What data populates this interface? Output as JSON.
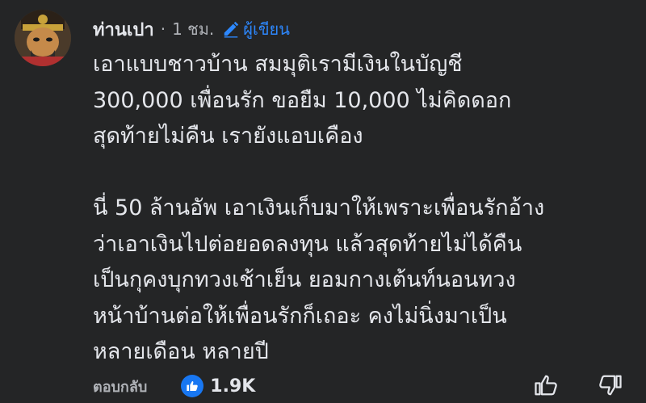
{
  "comment": {
    "author": "ท่านเปา",
    "separator": "·",
    "time": "1 ชม.",
    "badge": "ผู้เขียน",
    "paragraphs": [
      "เอาแบบชาวบ้าน สมมุติเรามีเงินในบัญชี\n300,000 เพื่อนรัก ขอยืม 10,000 ไม่คิดดอก\nสุดท้ายไม่คืน เรายังแอบเคือง",
      "นี่ 50 ล้านอัพ เอาเงินเก็บมาให้เพราะเพื่อนรักอ้าง\nว่าเอาเงินไปต่อยอดลงทุน แล้วสุดท้ายไม่ได้คืน\nเป็นกุคงบุกทวงเช้าเย็น ยอมกางเต้นท์นอนทวง\nหน้าบ้านต่อให้เพื่อนรักก็เถอะ คงไม่นิ่งมาเป็น\nหลายเดือน หลายปี"
    ]
  },
  "footer": {
    "reply_label": "ตอบกลับ",
    "like_count": "1.9K"
  },
  "colors": {
    "background": "#242526",
    "text": "#e4e6eb",
    "muted": "#b0b3b8",
    "accent": "#2d88ff",
    "like_blue": "#1877f2"
  },
  "icons": [
    "avatar-image",
    "pencil-icon",
    "like-icon",
    "thumbs-up-icon",
    "thumbs-down-icon"
  ]
}
